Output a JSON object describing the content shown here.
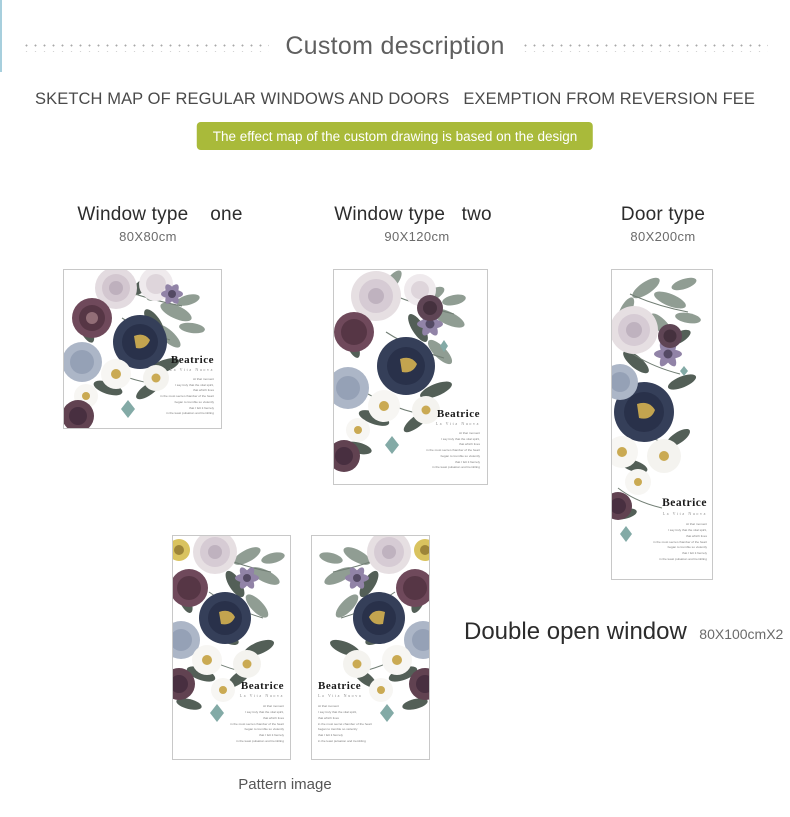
{
  "header": {
    "title": "Custom description",
    "left_dots": "dotted-rule",
    "right_dots": "dotted-rule"
  },
  "subtitle": "SKETCH MAP OF REGULAR WINDOWS AND DOORS   EXEMPTION FROM REVERSION FEE",
  "banner": {
    "text": "The effect map of the custom drawing is based on the design",
    "background": "#a9ba3a",
    "color": "#ffffff"
  },
  "labels": {
    "window_one": {
      "name": "Window type    one",
      "size": "80X80cm"
    },
    "window_two": {
      "name": "Window type   two",
      "size": "90X120cm"
    },
    "door": {
      "name": "Door type",
      "size": "80X200cm"
    },
    "double": {
      "name": "Double open window",
      "size": "80X100cmX2"
    }
  },
  "caption": "Pattern image",
  "poster": {
    "brand": "Beatrice",
    "subtitle": "La Vita Nuova",
    "poem": [
      "At that moment",
      "I say truly that the vital spirit,",
      "that which lives",
      "in the most secret chamber of the heart",
      "began to tremble so violently",
      "that I felt it fiercely",
      "in the least pulsation and trembling"
    ]
  },
  "panels": [
    {
      "id": "window-one",
      "label": "Window type one poster"
    },
    {
      "id": "window-two",
      "label": "Window type two poster"
    },
    {
      "id": "door",
      "label": "Door type poster"
    },
    {
      "id": "double-left",
      "label": "Double open window left leaf"
    },
    {
      "id": "double-right",
      "label": "Double open window right leaf"
    }
  ],
  "colors": {
    "accent_green": "#a9ba3a",
    "edge_blue": "#a7cfdd",
    "dot_gray": "#9a9a9a",
    "title_gray": "#5f5f5f",
    "panel_border": "#c8c8c8",
    "bloom_navy": "#2a3350",
    "bloom_plum": "#5c3c4c",
    "bloom_mauve": "#b9a7bd",
    "bloom_blush": "#d9cdd6",
    "bloom_white": "#f2f2f0",
    "leaf_sage": "#8d9a90",
    "leaf_dark": "#4e5a52"
  }
}
